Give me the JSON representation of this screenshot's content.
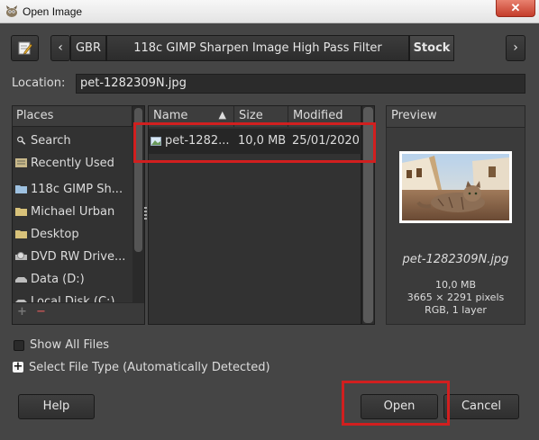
{
  "window": {
    "title": "Open Image",
    "close_label": "✕"
  },
  "path_bar": {
    "crumbs": [
      "GBR",
      "118c GIMP Sharpen Image High Pass Filter",
      "Stock"
    ],
    "prev_arrow": "‹",
    "next_arrow": "›"
  },
  "location": {
    "label": "Location:",
    "value": "pet-1282309N.jpg"
  },
  "places": {
    "header": "Places",
    "items": [
      {
        "label": "Search",
        "icon": "search-icon"
      },
      {
        "label": "Recently Used",
        "icon": "recent-icon"
      },
      {
        "label": "118c GIMP Sh...",
        "icon": "folder-icon"
      },
      {
        "label": "Michael Urban",
        "icon": "folder-icon"
      },
      {
        "label": "Desktop",
        "icon": "folder-icon"
      },
      {
        "label": "DVD RW Drive...",
        "icon": "optical-drive-icon"
      },
      {
        "label": "Data (D:)",
        "icon": "drive-icon"
      },
      {
        "label": "Local Disk (C:)",
        "icon": "drive-icon"
      }
    ],
    "add_label": "+",
    "remove_label": "−"
  },
  "file_list": {
    "columns": [
      "Name",
      "Size",
      "Modified"
    ],
    "sort_indicator": "▲",
    "rows": [
      {
        "name": "pet-1282...",
        "size": "10,0 MB",
        "modified": "25/01/2020"
      }
    ]
  },
  "preview": {
    "header": "Preview",
    "filename": "pet-1282309N.jpg",
    "size": "10,0 MB",
    "dimensions": "3665 × 2291 pixels",
    "mode": "RGB, 1 layer"
  },
  "options": {
    "show_all_files": "Show All Files",
    "select_file_type": "Select File Type (Automatically Detected)",
    "expander": "+"
  },
  "buttons": {
    "help": "Help",
    "open": "Open",
    "cancel": "Cancel"
  },
  "colors": {
    "highlight": "#d11f1f",
    "background": "#454545",
    "panel": "#323232"
  }
}
